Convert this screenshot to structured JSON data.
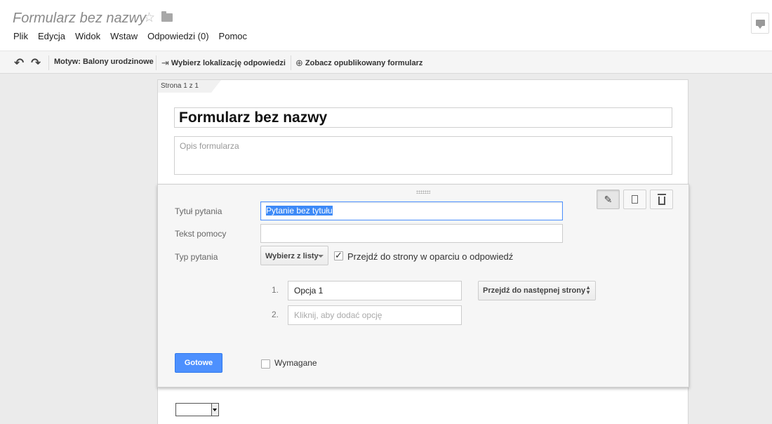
{
  "header": {
    "doc_title": "Formularz bez nazwy",
    "star_icon": "star-icon",
    "folder_icon": "folder-icon",
    "comment_icon": "comment-icon"
  },
  "menu": [
    "Plik",
    "Edycja",
    "Widok",
    "Wstaw",
    "Odpowiedzi (0)",
    "Pomoc"
  ],
  "toolbar": {
    "theme_label": "Motyw: Balony urodzinowe",
    "response_dest_label": "Wybierz lokalizację odpowiedzi",
    "view_published_label": "Zobacz opublikowany formularz"
  },
  "page": {
    "tab_label": "Strona 1 z 1",
    "form_title": "Formularz bez nazwy",
    "description_placeholder": "Opis formularza"
  },
  "question": {
    "title_label": "Tytuł pytania",
    "title_value": "Pytanie bez tytułu",
    "help_label": "Tekst pomocy",
    "help_value": "",
    "type_label": "Typ pytania",
    "type_value": "Wybierz z listy",
    "page_nav_label": "Przejdź do strony w oparciu o odpowiedź",
    "page_nav_checked": true,
    "options": [
      {
        "number": "1.",
        "value": "Opcja 1",
        "navigation": "Przejdź do następnej strony"
      },
      {
        "number": "2.",
        "placeholder": "Kliknij, aby dodać opcję"
      }
    ],
    "done_label": "Gotowe",
    "required_label": "Wymagane",
    "required_checked": false
  },
  "colors": {
    "accent": "#4d90fe",
    "selection": "#3d8af7"
  }
}
